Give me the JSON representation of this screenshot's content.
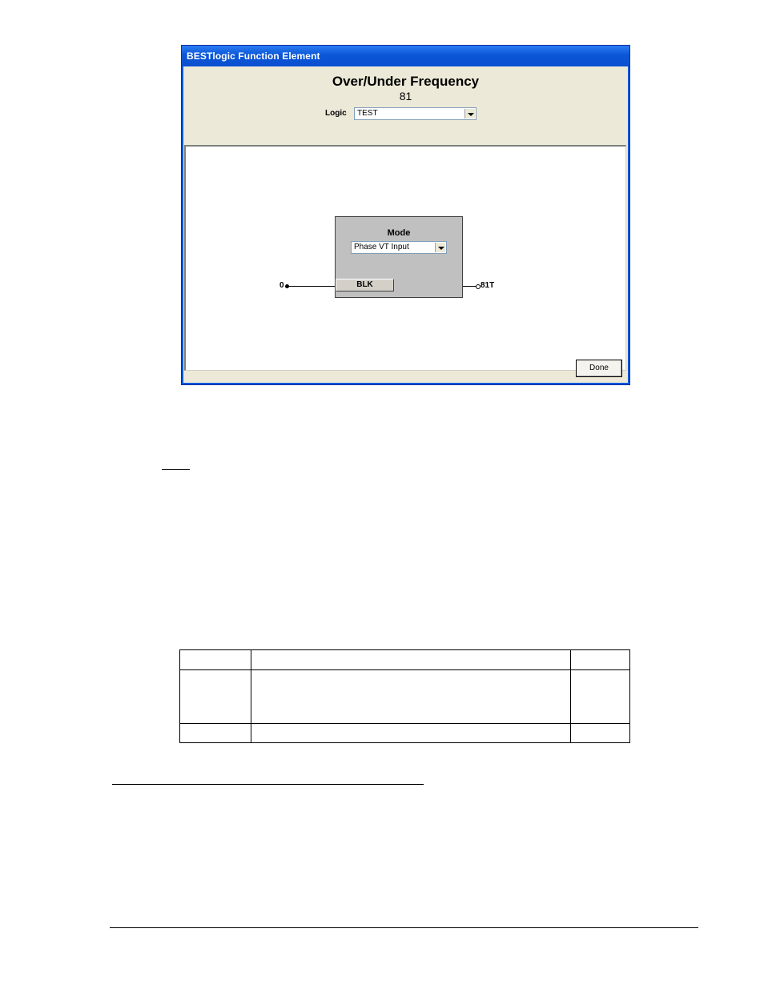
{
  "window": {
    "title": "BESTlogic Function Element"
  },
  "header": {
    "title": "Over/Under Frequency",
    "subtitle": "81"
  },
  "logic": {
    "label": "Logic",
    "value": "TEST"
  },
  "block": {
    "mode_label": "Mode",
    "mode_value": "Phase VT Input",
    "blk_label": "BLK",
    "input_value": "0",
    "output_label": "81T"
  },
  "footer": {
    "done_label": "Done"
  }
}
